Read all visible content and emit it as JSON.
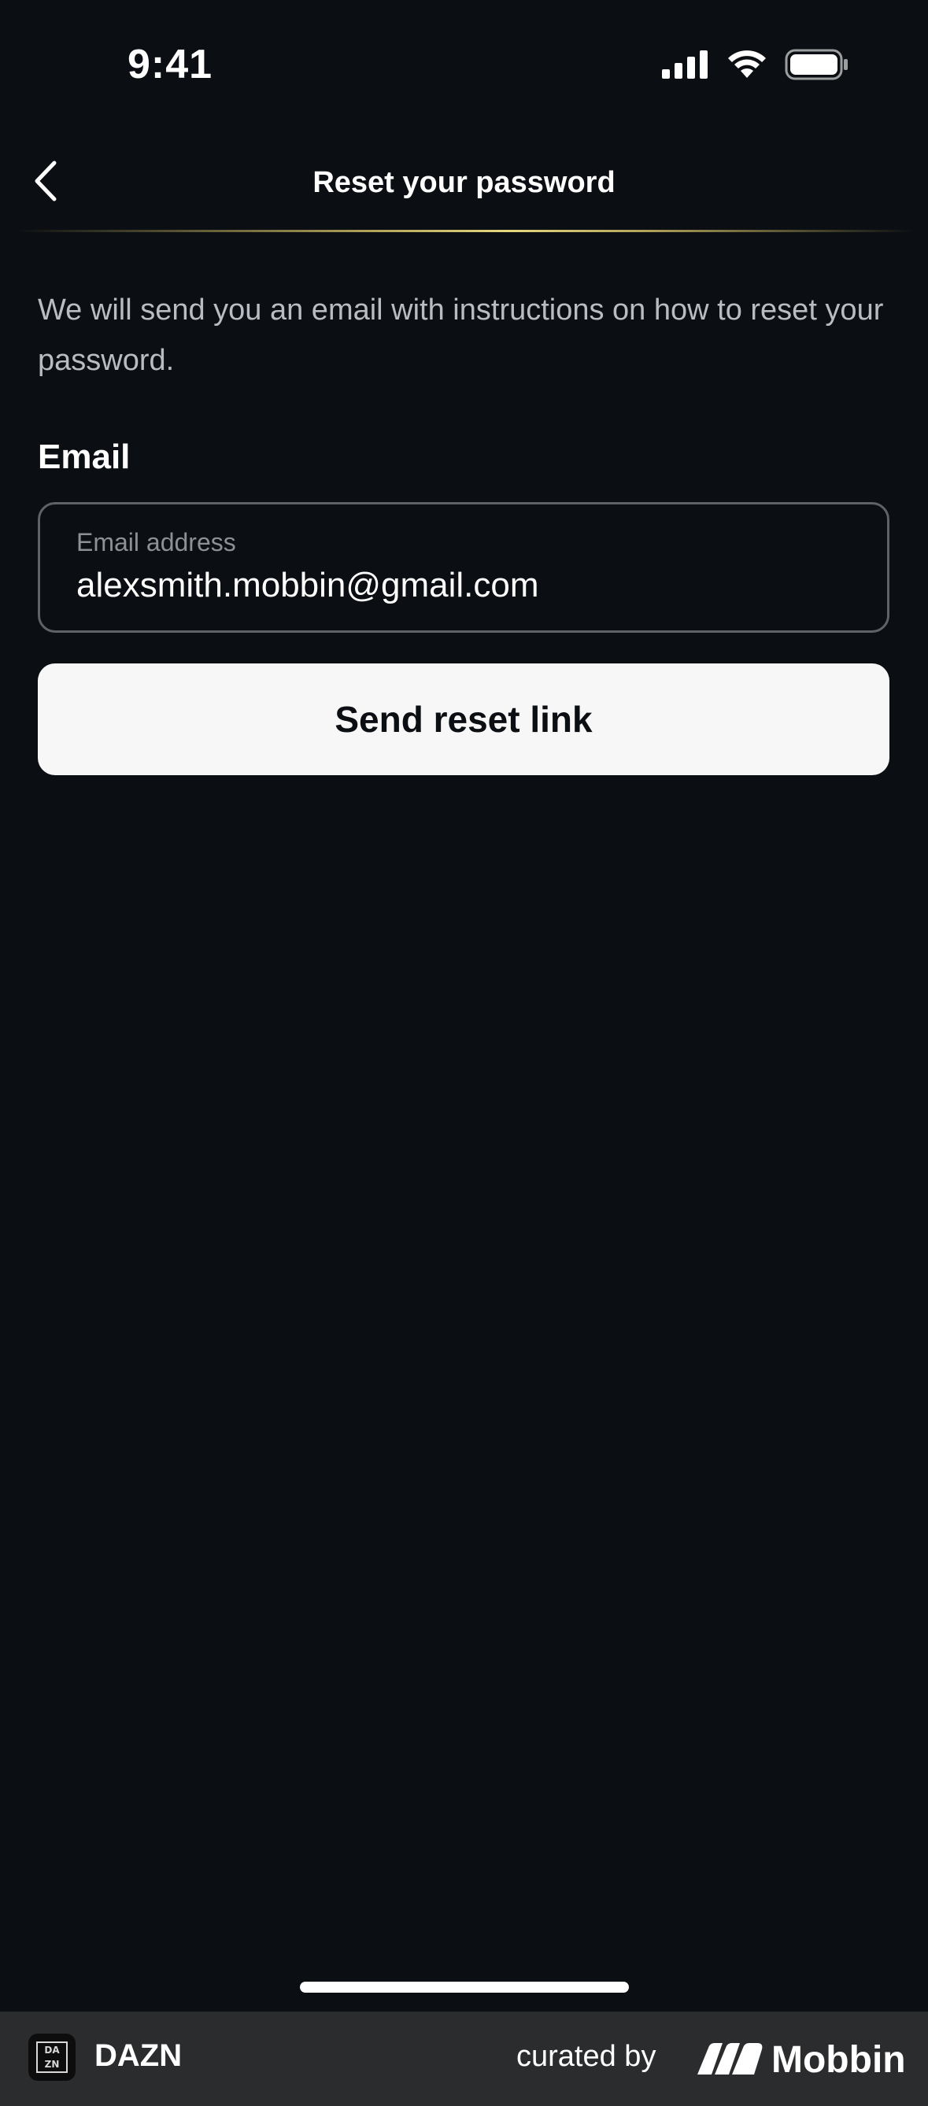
{
  "status_bar": {
    "time": "9:41"
  },
  "header": {
    "title": "Reset your password"
  },
  "content": {
    "instructions": "We will send you an email with instructions on how to reset your password.",
    "email_label": "Email",
    "email_placeholder": "Email address",
    "email_value": "alexsmith.mobbin@gmail.com",
    "send_button_label": "Send reset link"
  },
  "footer": {
    "app_name": "DAZN",
    "app_logo_letters": [
      "DA",
      "ZN"
    ],
    "curated_by": "curated by",
    "brand": "Mobbin"
  },
  "colors": {
    "background": "#0b0e12",
    "button_bg": "#f7f7f7",
    "accent_gold": "#e6d77f",
    "banner_bg": "#2b2c2e"
  }
}
